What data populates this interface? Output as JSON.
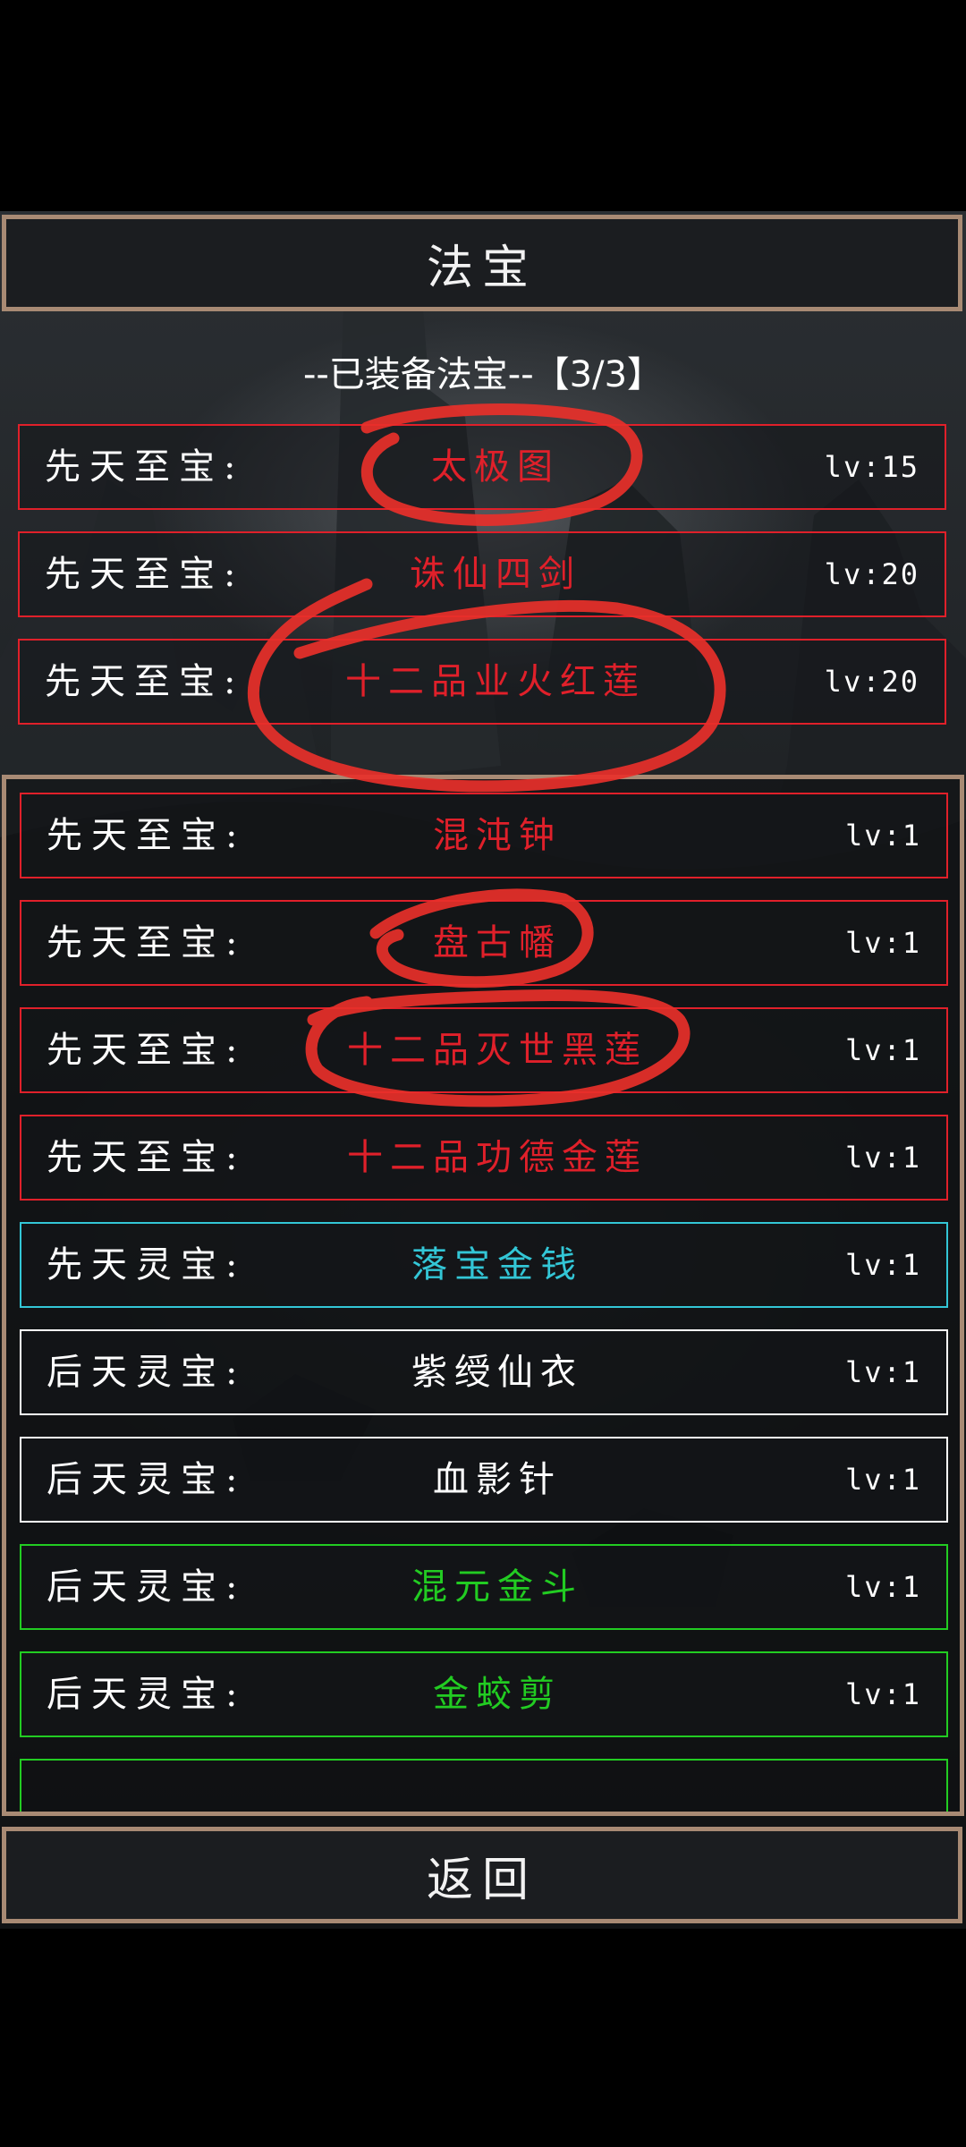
{
  "title": "法宝",
  "back_label": "返回",
  "equipped_header": "--已装备法宝--【3/3】",
  "colors": {
    "red": "#e0202a",
    "cyan": "#33c6d6",
    "white": "#ffffff",
    "green": "#22cc22",
    "frame": "#a88a74"
  },
  "equipped": [
    {
      "type": "先天至宝:",
      "name": "太极图",
      "level": "lv:15",
      "color": "red"
    },
    {
      "type": "先天至宝:",
      "name": "诛仙四剑",
      "level": "lv:20",
      "color": "red"
    },
    {
      "type": "先天至宝:",
      "name": "十二品业火红莲",
      "level": "lv:20",
      "color": "red"
    }
  ],
  "inventory": [
    {
      "type": "先天至宝:",
      "name": "混沌钟",
      "level": "lv:1",
      "color": "red"
    },
    {
      "type": "先天至宝:",
      "name": "盘古幡",
      "level": "lv:1",
      "color": "red"
    },
    {
      "type": "先天至宝:",
      "name": "十二品灭世黑莲",
      "level": "lv:1",
      "color": "red"
    },
    {
      "type": "先天至宝:",
      "name": "十二品功德金莲",
      "level": "lv:1",
      "color": "red"
    },
    {
      "type": "先天灵宝:",
      "name": "落宝金钱",
      "level": "lv:1",
      "color": "cyan"
    },
    {
      "type": "后天灵宝:",
      "name": "紫绶仙衣",
      "level": "lv:1",
      "color": "white"
    },
    {
      "type": "后天灵宝:",
      "name": "血影针",
      "level": "lv:1",
      "color": "white"
    },
    {
      "type": "后天灵宝:",
      "name": "混元金斗",
      "level": "lv:1",
      "color": "green"
    },
    {
      "type": "后天灵宝:",
      "name": "金蛟剪",
      "level": "lv:1",
      "color": "green"
    }
  ]
}
